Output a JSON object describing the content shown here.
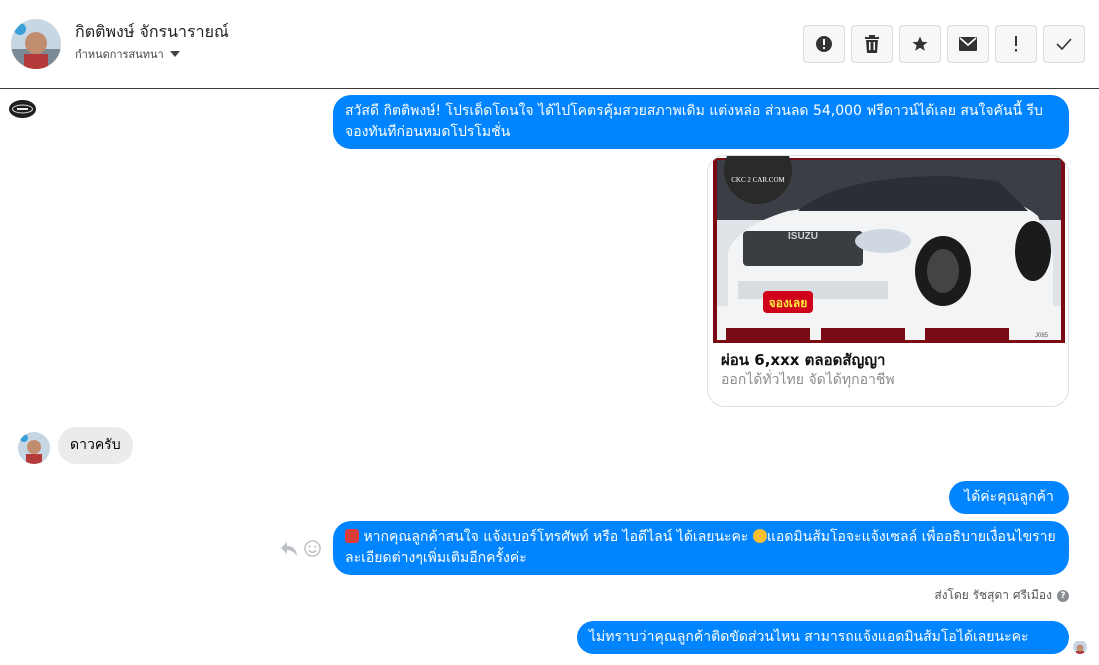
{
  "header": {
    "name": "กิตติพงษ์ จักรนารายณ์",
    "subtitle": "กำหนดการสนทนา"
  },
  "toolbar": {
    "buttons": [
      {
        "icon": "alert-circle-icon"
      },
      {
        "icon": "trash-icon"
      },
      {
        "icon": "star-icon"
      },
      {
        "icon": "envelope-icon"
      },
      {
        "icon": "exclamation-icon"
      },
      {
        "icon": "checkmark-icon"
      }
    ]
  },
  "messages": {
    "m1": "สวัสดี กิตติพงษ์! โปรเด็ดโดนใจ ได้ไปโคตรคุ้มสวยสภาพเดิม แต่งหล่อ  ส่วนลด 54,000 ฟรีดาวน์ได้เลย  สนใจคันนี้ รีบจองทันทีก่อนหมดโปรโมชั่น",
    "card": {
      "title": "ผ่อน 6,xxx ตลอดสัญญา",
      "subtitle": "ออกได้ทั่วไทย จัดได้ทุกอาชีพ",
      "image_text": {
        "brand": "ISUZU",
        "badge": "จองเลย",
        "watermark": "CKC 2 CAR.COM",
        "code": "J085"
      }
    },
    "m2": "ดาวครับ",
    "m3": "ได้ค่ะคุณลูกค้า",
    "m4a": "หากคุณลูกค้าสนใจ แจ้งเบอร์โทรศัพท์ หรือ ไอดีไลน์  ได้เลยนะคะ ",
    "m4b": "แอดมินส้มโอจะแจ้งเซลล์   เพื่ออธิบายเงื่อนไขรายละเอียดต่างๆเพิ่มเติมอีกครั้งค่ะ",
    "sent_by": "ส่งโดย รัชสุดา ศรีเมือง",
    "m5": "ไม่ทราบว่าคุณลูกค้าติดขัดส่วนไหน สามารถแจ้งแอดมินส้มโอได้เลยนะคะ"
  },
  "colors": {
    "outgoing": "#0084ff",
    "incoming": "#ebebeb",
    "badge_red": "#d0021b"
  }
}
